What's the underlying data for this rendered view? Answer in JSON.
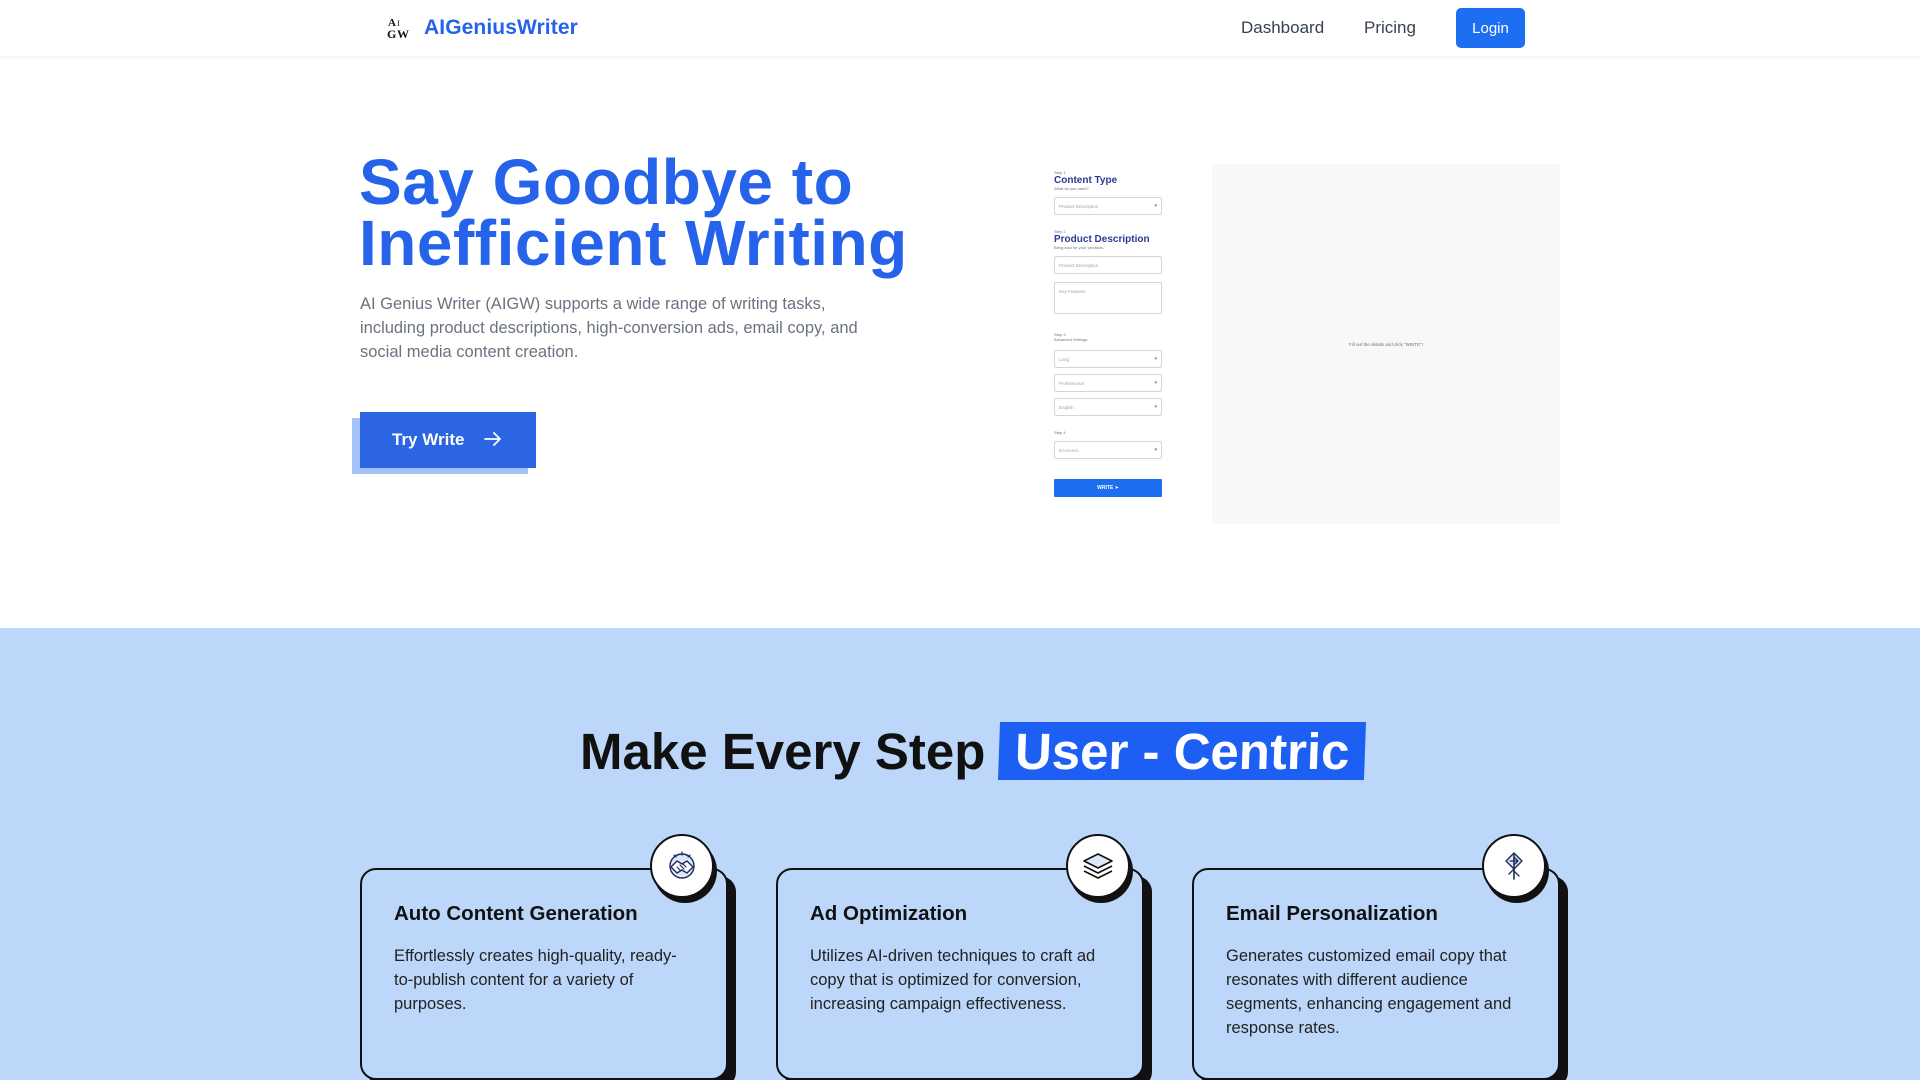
{
  "nav": {
    "brand": "AIGeniusWriter",
    "logo_icon": "aw-monogram-logo",
    "links": [
      "Dashboard",
      "Pricing"
    ],
    "login": "Login",
    "accent": "#1d6ff2"
  },
  "hero": {
    "title_line1": "Say Goodbye to",
    "title_line2": "Inefficient Writing",
    "description": "AI Genius Writer (AIGW) supports a wide range of writing tasks, including product descriptions, high-conversion ads, email copy, and social media content creation.",
    "cta": "Try Write",
    "cta_icon": "arrow-right-icon",
    "title_color": "#2563eb"
  },
  "preview": {
    "step1": "Step 1",
    "content_type_heading": "Content Type",
    "content_type_sub": "What do you need?",
    "content_type_value": "Product Description",
    "step2": "Step 2",
    "product_heading": "Product Description",
    "product_sub": "Bring soul for your products.",
    "product_name_placeholder": "Product Description",
    "features_placeholder": "Key Features",
    "step3": "Step 3",
    "advanced_label": "Advanced Settings",
    "length_value": "Long",
    "tone_value": "Professional",
    "language_value": "English",
    "step4": "Step 4",
    "model_value": "Economic",
    "write_button": "WRITE ➤",
    "output_hint": "Fill out the details and click \"WRITE\"!"
  },
  "features": {
    "heading_plain": "Make Every Step",
    "heading_highlight": "User - Centric",
    "highlight_color": "#1d5ff2",
    "background": "#bcd7fa",
    "cards": [
      {
        "title": "Auto Content Generation",
        "description": "Effortlessly creates high-quality, ready-to-publish content for a variety of purposes.",
        "icon": "handshake-icon"
      },
      {
        "title": "Ad Optimization",
        "description": "Utilizes AI-driven techniques to craft ad copy that is optimized for conversion, increasing campaign effectiveness.",
        "icon": "layers-icon"
      },
      {
        "title": "Email Personalization",
        "description": "Generates customized email copy that resonates with different audience segments, enhancing engagement and response rates.",
        "icon": "direction-sign-icon"
      }
    ]
  }
}
